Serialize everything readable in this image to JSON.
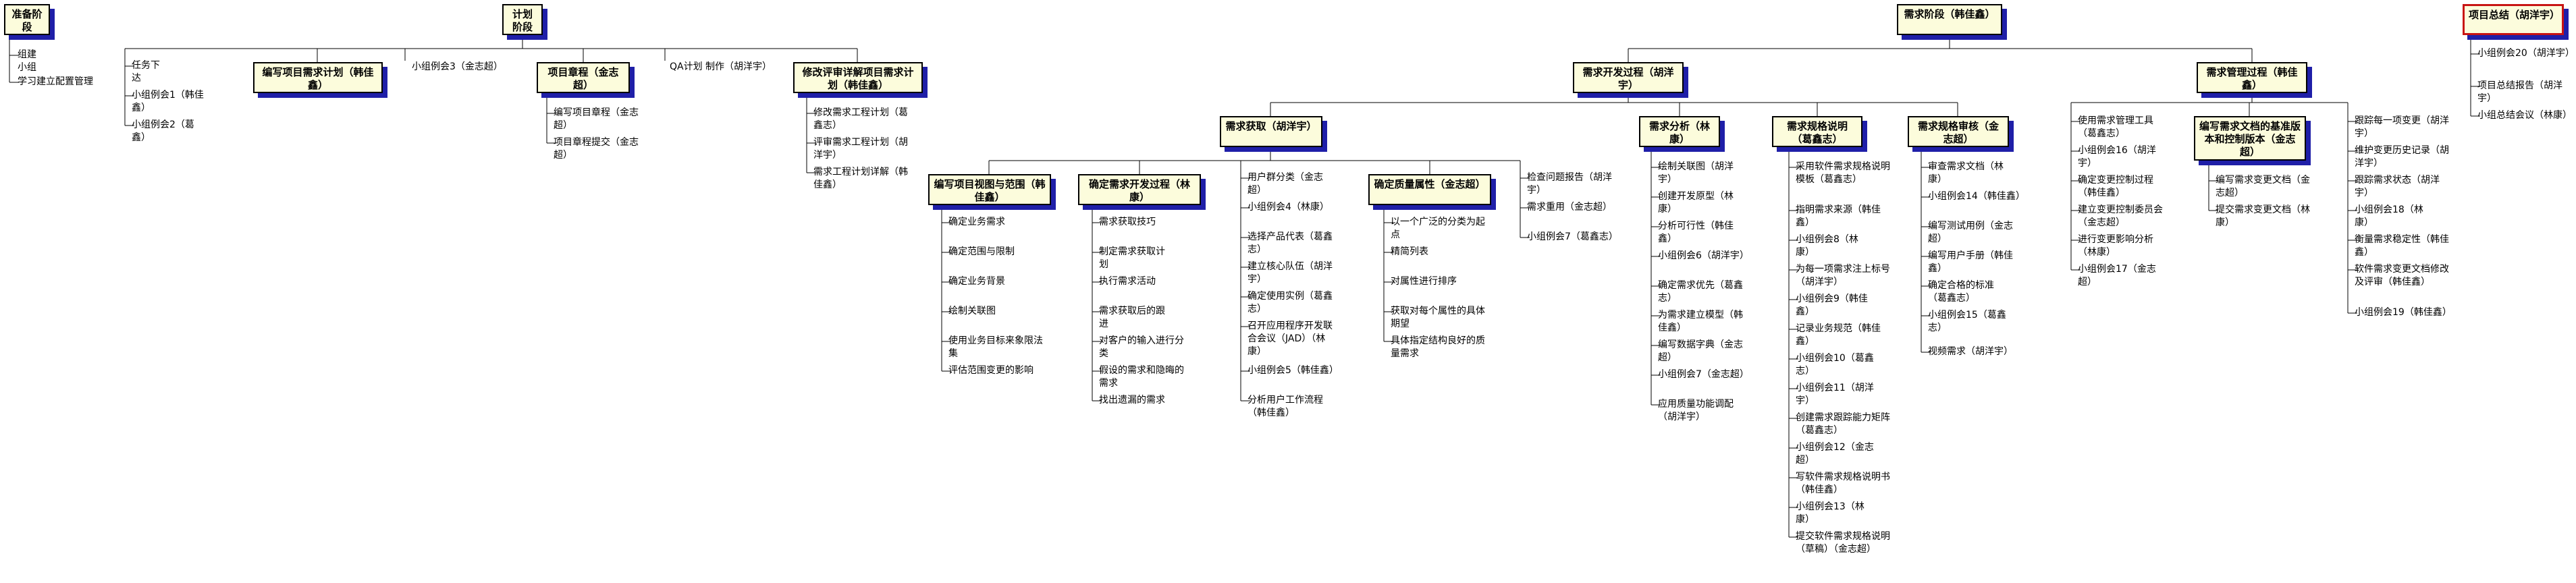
{
  "phases": [
    {
      "label": "准备阶段",
      "highlight": false,
      "items": [
        "组建小组",
        "学习建立配置管理"
      ]
    },
    {
      "label": "计划阶段",
      "highlight": false,
      "items": [
        "任务下达",
        "小组例会1（韩佳鑫）",
        "小组例会2（葛鑫）"
      ],
      "children": [
        {
          "label": "编写项目需求计划（韩佳鑫）",
          "items": []
        },
        {
          "label": "小组例会3（金志超）",
          "plain": true
        },
        {
          "label": "项目章程（金志超）",
          "items": [
            "编写项目章程（金志超）",
            "项目章程提交（金志超）"
          ]
        },
        {
          "label": "QA计划 制作（胡洋宇）",
          "plain": true
        },
        {
          "label": "修改评审详解项目需求计划（韩佳鑫）",
          "items": [
            "修改需求工程计划（葛鑫志）",
            "评审需求工程计划（胡洋宇）",
            "需求工程计划详解（韩佳鑫）"
          ]
        }
      ]
    },
    {
      "label": "需求阶段（韩佳鑫）",
      "highlight": false,
      "children": [
        {
          "label": "需求开发过程（胡洋宇）",
          "children": [
            {
              "label": "需求获取（胡洋宇）",
              "children": [
                {
                  "label": "编写项目视图与范围（韩佳鑫）",
                  "items": [
                    "确定业务需求",
                    "确定范围与限制",
                    "确定业务背景",
                    "绘制关联图",
                    "使用业务目标来象限法集",
                    "评估范围变更的影响"
                  ]
                },
                {
                  "label": "确定需求开发过程（林康）",
                  "items": [
                    "需求获取技巧",
                    "制定需求获取计划",
                    "执行需求活动",
                    "需求获取后的跟进",
                    "对客户的输入进行分类",
                    "假设的需求和隐晦的需求",
                    "找出遗漏的需求"
                  ]
                },
                {
                  "label": "用户群分类（金志超）",
                  "plain": true,
                  "items": [
                    "小组例会4（林康）",
                    "选择产品代表（葛鑫志）",
                    "建立核心队伍（胡洋宇）",
                    "确定使用实例（葛鑫志）",
                    "召开应用程序开发联合会议（JAD）（林康）",
                    "小组例会5（韩佳鑫）",
                    "分析用户工作流程（韩佳鑫）"
                  ]
                },
                {
                  "label": "确定质量属性（金志超）",
                  "items": [
                    "以一个广泛的分类为起点",
                    "精简列表",
                    "对属性进行排序",
                    "获取对每个属性的具体期望",
                    "具体指定结构良好的质量需求"
                  ]
                },
                {
                  "label": "检查问题报告（胡洋宇）",
                  "plain": true,
                  "items": [
                    "需求重用（金志超）",
                    "小组例会7（葛鑫志）"
                  ]
                }
              ]
            },
            {
              "label": "需求分析（林康）",
              "items": [
                "绘制关联图（胡洋宇）",
                "创建开发原型（林康）",
                "分析可行性（韩佳鑫）",
                "小组例会6（胡洋宇）",
                "确定需求优先（葛鑫志）",
                "为需求建立模型（韩佳鑫）",
                "编写数据字典（金志超）",
                "小组例会7（金志超）",
                "应用质量功能调配（胡洋宇）"
              ]
            },
            {
              "label": "需求规格说明（葛鑫志）",
              "items": [
                "采用软件需求规格说明模板（葛鑫志）",
                "指明需求来源（韩佳鑫）",
                "小组例会8（林康）",
                "为每一项需求注上标号（胡洋宇）",
                "小组例会9（韩佳鑫）",
                "记录业务规范（韩佳鑫）",
                "小组例会10（葛鑫志）",
                "小组例会11（胡洋宇）",
                "创建需求跟踪能力矩阵（葛鑫志）",
                "小组例会12（金志超）",
                "写软件需求规格说明书（韩佳鑫）",
                "小组例会13（林康）",
                "提交软件需求规格说明（草稿）（金志超）"
              ]
            },
            {
              "label": "需求规格审核（金志超）",
              "items": [
                "审查需求文档（林康）",
                "小组例会14（韩佳鑫）",
                "编写测试用例（金志超）",
                "编写用户手册（韩佳鑫）",
                "确定合格的标准（葛鑫志）",
                "小组例会15（葛鑫志）",
                "视频需求（胡洋宇）"
              ]
            }
          ]
        },
        {
          "label": "需求管理过程（韩佳鑫）",
          "items": [
            "使用需求管理工具（葛鑫志）",
            "小组例会16（胡洋宇）",
            "确定变更控制过程（韩佳鑫）",
            "建立变更控制委员会（金志超）",
            "进行变更影响分析（林康）",
            "小组例会17（金志超）"
          ],
          "children": [
            {
              "label": "编写需求文档的基准版本和控制版本（金志超）",
              "items": [
                "编写需求变更文档（金志超）",
                "提交需求变更文档（林康）"
              ]
            },
            {
              "label": "跟踪每一项变更（胡洋宇）",
              "plain": true,
              "items": [
                "维护变更历史记录（胡洋宇）",
                "跟踪需求状态（胡洋宇）",
                "小组例会18（林康）",
                "衡量需求稳定性（韩佳鑫）",
                "软件需求变更文档修改及评审（韩佳鑫）",
                "小组例会19（韩佳鑫）"
              ]
            }
          ]
        }
      ]
    },
    {
      "label": "项目总结（胡洋宇）",
      "highlight": true,
      "items": [
        "小组例会20（胡洋宇）",
        "项目总结报告（胡洋宇）",
        "小组总结会议（林康）"
      ]
    }
  ]
}
